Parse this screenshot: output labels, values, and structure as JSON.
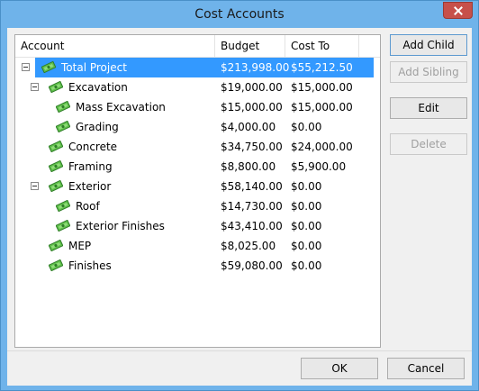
{
  "window": {
    "title": "Cost Accounts"
  },
  "columns": {
    "account": "Account",
    "budget": "Budget",
    "cost": "Cost To Date"
  },
  "rows": [
    {
      "name": "Total Project",
      "budget": "$213,998.00",
      "cost": "$55,212.50",
      "expander": "collapse",
      "level": 0,
      "selected": true
    },
    {
      "name": "Excavation",
      "budget": "$19,000.00",
      "cost": "$15,000.00",
      "expander": "collapse",
      "level": 1
    },
    {
      "name": "Mass Excavation",
      "budget": "$15,000.00",
      "cost": "$15,000.00",
      "level": 2
    },
    {
      "name": "Grading",
      "budget": "$4,000.00",
      "cost": "$0.00",
      "level": 2
    },
    {
      "name": "Concrete",
      "budget": "$34,750.00",
      "cost": "$24,000.00",
      "level": 1
    },
    {
      "name": "Framing",
      "budget": "$8,800.00",
      "cost": "$5,900.00",
      "level": 1
    },
    {
      "name": "Exterior",
      "budget": "$58,140.00",
      "cost": "$0.00",
      "expander": "collapse",
      "level": 1
    },
    {
      "name": "Roof",
      "budget": "$14,730.00",
      "cost": "$0.00",
      "level": 2
    },
    {
      "name": "Exterior Finishes",
      "budget": "$43,410.00",
      "cost": "$0.00",
      "level": 2
    },
    {
      "name": "MEP",
      "budget": "$8,025.00",
      "cost": "$0.00",
      "level": 1
    },
    {
      "name": "Finishes",
      "budget": "$59,080.00",
      "cost": "$0.00",
      "level": 1
    }
  ],
  "buttons": {
    "add_child": "Add Child",
    "add_sibling": "Add Sibling",
    "edit": "Edit",
    "delete": "Delete",
    "ok": "OK",
    "cancel": "Cancel"
  },
  "icon": "money-icon",
  "colors": {
    "selection": "#3399ff",
    "titlebar": "#6fb3ea",
    "close": "#c7504a"
  }
}
